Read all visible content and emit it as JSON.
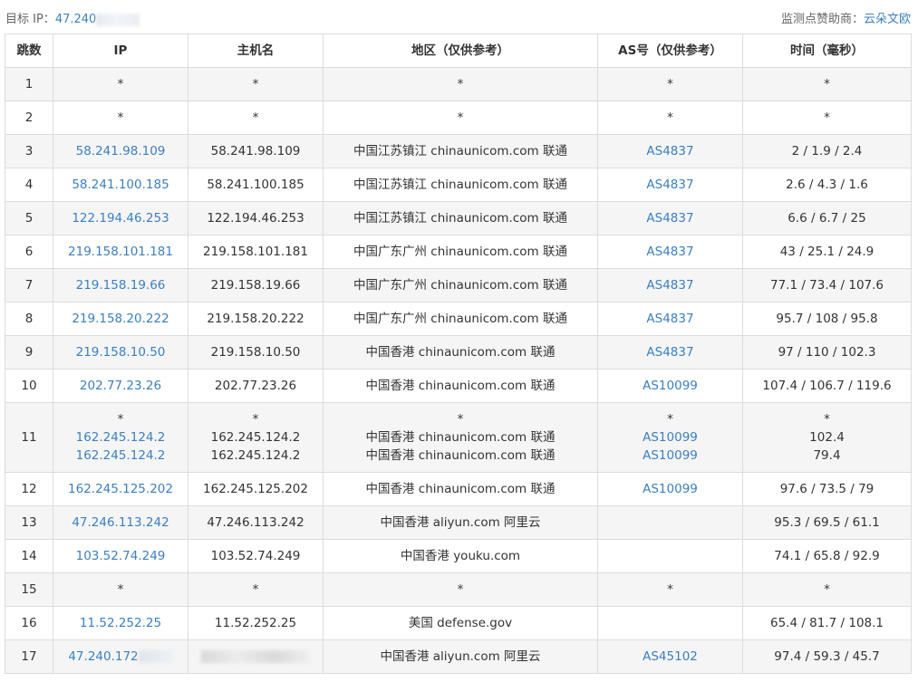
{
  "header": {
    "target_label": "目标 IP：",
    "target_ip": "47.240",
    "sponsor_label": "监测点赞助商：",
    "sponsor_name": "云朵文欧"
  },
  "table": {
    "columns": [
      "跳数",
      "IP",
      "主机名",
      "地区（仅供参考）",
      "AS号（仅供参考）",
      "时间（毫秒）"
    ],
    "rows": [
      {
        "hop": "1",
        "ip": [
          "*"
        ],
        "host": [
          "*"
        ],
        "region": [
          "*"
        ],
        "as": [
          "*"
        ],
        "time": [
          "*"
        ]
      },
      {
        "hop": "2",
        "ip": [
          "*"
        ],
        "host": [
          "*"
        ],
        "region": [
          "*"
        ],
        "as": [
          "*"
        ],
        "time": [
          "*"
        ]
      },
      {
        "hop": "3",
        "ip": [
          "58.241.98.109"
        ],
        "host": [
          "58.241.98.109"
        ],
        "region": [
          "中国江苏镇江 chinaunicom.com 联通"
        ],
        "as": [
          "AS4837"
        ],
        "time": [
          "2 / 1.9 / 2.4"
        ]
      },
      {
        "hop": "4",
        "ip": [
          "58.241.100.185"
        ],
        "host": [
          "58.241.100.185"
        ],
        "region": [
          "中国江苏镇江 chinaunicom.com 联通"
        ],
        "as": [
          "AS4837"
        ],
        "time": [
          "2.6 / 4.3 / 1.6"
        ]
      },
      {
        "hop": "5",
        "ip": [
          "122.194.46.253"
        ],
        "host": [
          "122.194.46.253"
        ],
        "region": [
          "中国江苏镇江 chinaunicom.com 联通"
        ],
        "as": [
          "AS4837"
        ],
        "time": [
          "6.6 / 6.7 / 25"
        ]
      },
      {
        "hop": "6",
        "ip": [
          "219.158.101.181"
        ],
        "host": [
          "219.158.101.181"
        ],
        "region": [
          "中国广东广州 chinaunicom.com 联通"
        ],
        "as": [
          "AS4837"
        ],
        "time": [
          "43 / 25.1 / 24.9"
        ]
      },
      {
        "hop": "7",
        "ip": [
          "219.158.19.66"
        ],
        "host": [
          "219.158.19.66"
        ],
        "region": [
          "中国广东广州 chinaunicom.com 联通"
        ],
        "as": [
          "AS4837"
        ],
        "time": [
          "77.1 / 73.4 / 107.6"
        ]
      },
      {
        "hop": "8",
        "ip": [
          "219.158.20.222"
        ],
        "host": [
          "219.158.20.222"
        ],
        "region": [
          "中国广东广州 chinaunicom.com 联通"
        ],
        "as": [
          "AS4837"
        ],
        "time": [
          "95.7 / 108 / 95.8"
        ]
      },
      {
        "hop": "9",
        "ip": [
          "219.158.10.50"
        ],
        "host": [
          "219.158.10.50"
        ],
        "region": [
          "中国香港 chinaunicom.com 联通"
        ],
        "as": [
          "AS4837"
        ],
        "time": [
          "97 / 110 / 102.3"
        ]
      },
      {
        "hop": "10",
        "ip": [
          "202.77.23.26"
        ],
        "host": [
          "202.77.23.26"
        ],
        "region": [
          "中国香港 chinaunicom.com 联通"
        ],
        "as": [
          "AS10099"
        ],
        "time": [
          "107.4 / 106.7 / 119.6"
        ]
      },
      {
        "hop": "11",
        "ip": [
          "*",
          "162.245.124.2",
          "162.245.124.2"
        ],
        "host": [
          "*",
          "162.245.124.2",
          "162.245.124.2"
        ],
        "region": [
          "*",
          "中国香港 chinaunicom.com 联通",
          "中国香港 chinaunicom.com 联通"
        ],
        "as": [
          "*",
          "AS10099",
          "AS10099"
        ],
        "time": [
          "*",
          "102.4",
          "79.4"
        ]
      },
      {
        "hop": "12",
        "ip": [
          "162.245.125.202"
        ],
        "host": [
          "162.245.125.202"
        ],
        "region": [
          "中国香港 chinaunicom.com 联通"
        ],
        "as": [
          "AS10099"
        ],
        "time": [
          "97.6 / 73.5 / 79"
        ]
      },
      {
        "hop": "13",
        "ip": [
          "47.246.113.242"
        ],
        "host": [
          "47.246.113.242"
        ],
        "region": [
          "中国香港 aliyun.com 阿里云"
        ],
        "as": [
          ""
        ],
        "time": [
          "95.3 / 69.5 / 61.1"
        ]
      },
      {
        "hop": "14",
        "ip": [
          "103.52.74.249"
        ],
        "host": [
          "103.52.74.249"
        ],
        "region": [
          "中国香港 youku.com"
        ],
        "as": [
          ""
        ],
        "time": [
          "74.1 / 65.8 / 92.9"
        ]
      },
      {
        "hop": "15",
        "ip": [
          "*"
        ],
        "host": [
          "*"
        ],
        "region": [
          "*"
        ],
        "as": [
          "*"
        ],
        "time": [
          "*"
        ]
      },
      {
        "hop": "16",
        "ip": [
          "11.52.252.25"
        ],
        "host": [
          "11.52.252.25"
        ],
        "region": [
          "美国 defense.gov"
        ],
        "as": [
          ""
        ],
        "time": [
          "65.4 / 81.7 / 108.1"
        ]
      },
      {
        "hop": "17",
        "ip": [
          "47.240.172"
        ],
        "host": [
          ""
        ],
        "region": [
          "中国香港 aliyun.com 阿里云"
        ],
        "as": [
          "AS45102"
        ],
        "time": [
          "97.4 / 59.3 / 45.7"
        ]
      }
    ]
  },
  "colors": {
    "link": "#3a7fc4",
    "row_alt": "#f5f5f5",
    "border": "#dcdcdc"
  }
}
